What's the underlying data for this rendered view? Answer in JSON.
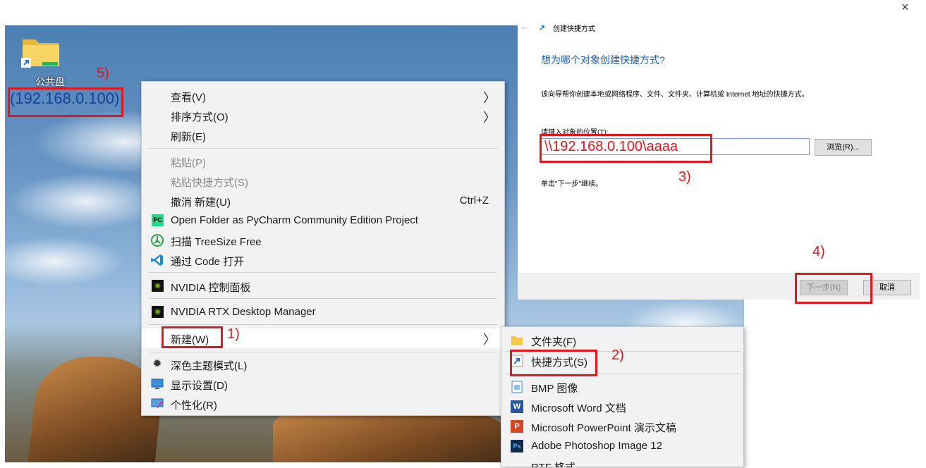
{
  "close_glyph": "×",
  "desktop": {
    "icon_label": "公共盘",
    "icon_address": "(192.168.0.100)"
  },
  "annotations": {
    "n1": "1)",
    "n2": "2)",
    "n3": "3)",
    "n4": "4)",
    "n5": "5)"
  },
  "context_menu": {
    "view": "查看(V)",
    "sort": "排序方式(O)",
    "refresh": "刷新(E)",
    "paste": "粘贴(P)",
    "paste_shortcut": "粘贴快捷方式(S)",
    "undo": "撤消 新建(U)",
    "undo_shortcut": "Ctrl+Z",
    "pycharm": "Open Folder as PyCharm Community Edition Project",
    "treesize": "扫描 TreeSize Free",
    "vscode": "通过 Code 打开",
    "nvidia_cp": "NVIDIA 控制面板",
    "nvidia_rtx": "NVIDIA RTX Desktop Manager",
    "new": "新建(W)",
    "dark_mode": "深色主题模式(L)",
    "display": "显示设置(D)",
    "personalize": "个性化(R)",
    "arrow": "〉"
  },
  "submenu": {
    "folder": "文件夹(F)",
    "shortcut": "快捷方式(S)",
    "bmp": "BMP 图像",
    "word": "Microsoft Word 文档",
    "ppt": "Microsoft PowerPoint 演示文稿",
    "psd": "Adobe Photoshop Image 12",
    "partial": "RTF 格式"
  },
  "wizard": {
    "back_glyph": "←",
    "title": "创建快捷方式",
    "heading": "想为哪个对象创建快捷方式?",
    "desc": "该向导帮你创建本地或网络程序、文件、文件夹、计算机或 Internet 地址的快捷方式。",
    "location_label": "请键入对象的位置(T):",
    "location_value": "\\\\192.168.0.100\\aaaa",
    "browse": "浏览(R)...",
    "hint": "单击\"下一步\"继续。",
    "next": "下一步(N)",
    "cancel": "取消"
  },
  "colors": {
    "annotation_red": "#e0171e",
    "heading_blue": "#1a5fb4"
  }
}
